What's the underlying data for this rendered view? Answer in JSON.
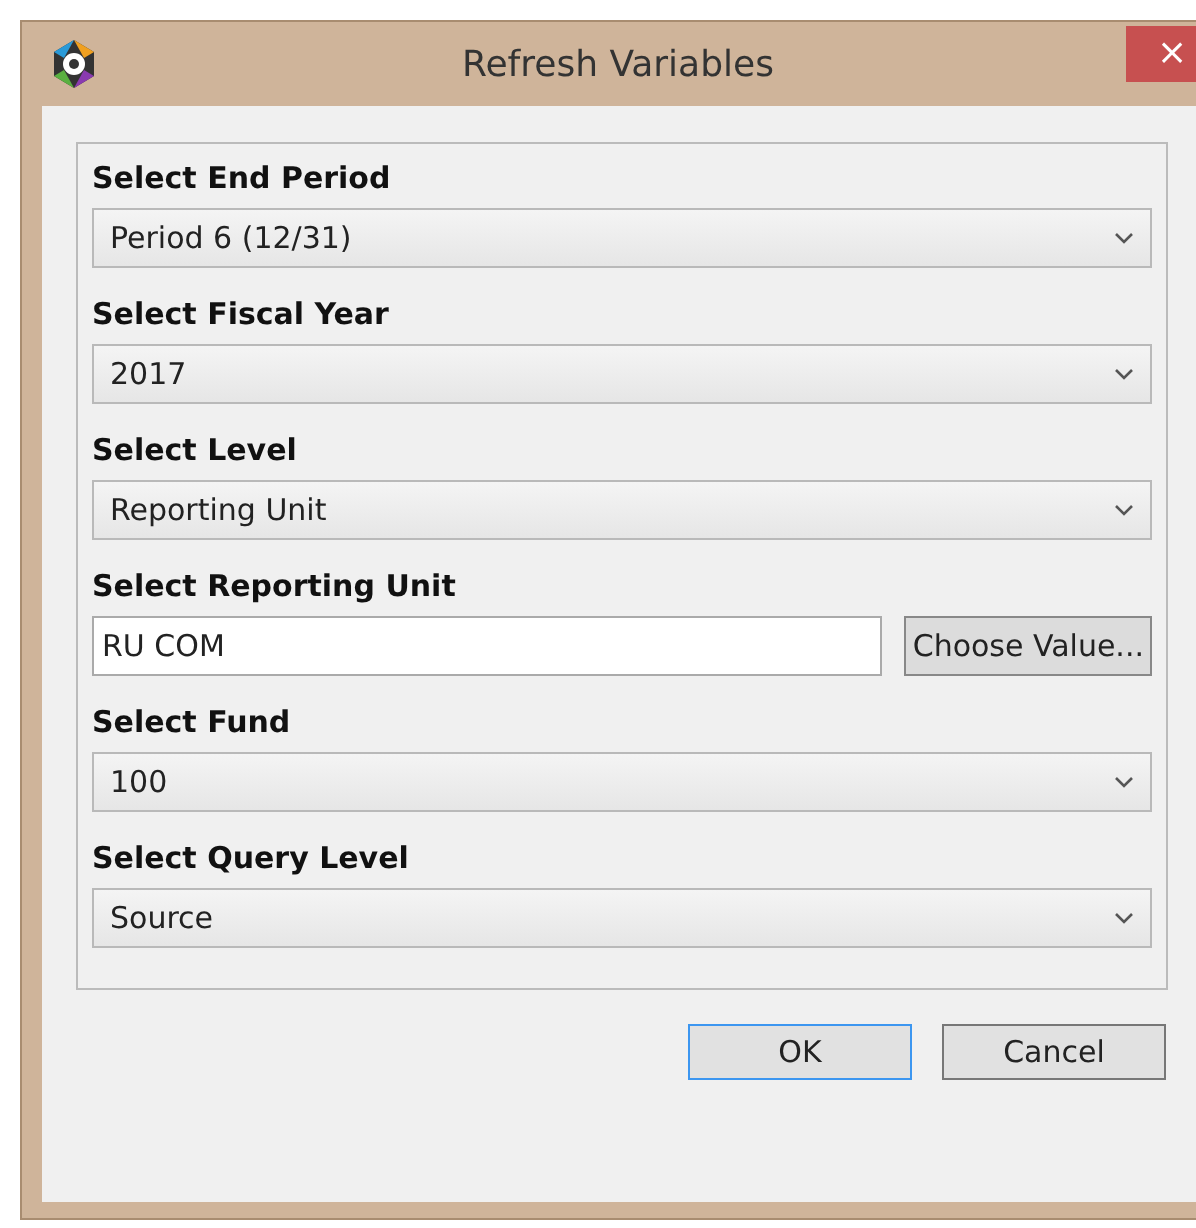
{
  "window": {
    "title": "Refresh Variables",
    "close": "×"
  },
  "fields": [
    {
      "kind": "select",
      "label": "Select End Period",
      "value": "Period 6 (12/31)"
    },
    {
      "kind": "select",
      "label": "Select Fiscal Year",
      "value": "2017"
    },
    {
      "kind": "select",
      "label": "Select Level",
      "value": "Reporting Unit"
    },
    {
      "kind": "text",
      "label": "Select Reporting Unit",
      "value": "RU COM",
      "button": "Choose Value..."
    },
    {
      "kind": "select",
      "label": "Select Fund",
      "value": "100"
    },
    {
      "kind": "select",
      "label": "Select Query Level",
      "value": "Source"
    }
  ],
  "buttons": [
    {
      "label": "OK",
      "focused": true
    },
    {
      "label": "Cancel",
      "focused": false
    }
  ]
}
